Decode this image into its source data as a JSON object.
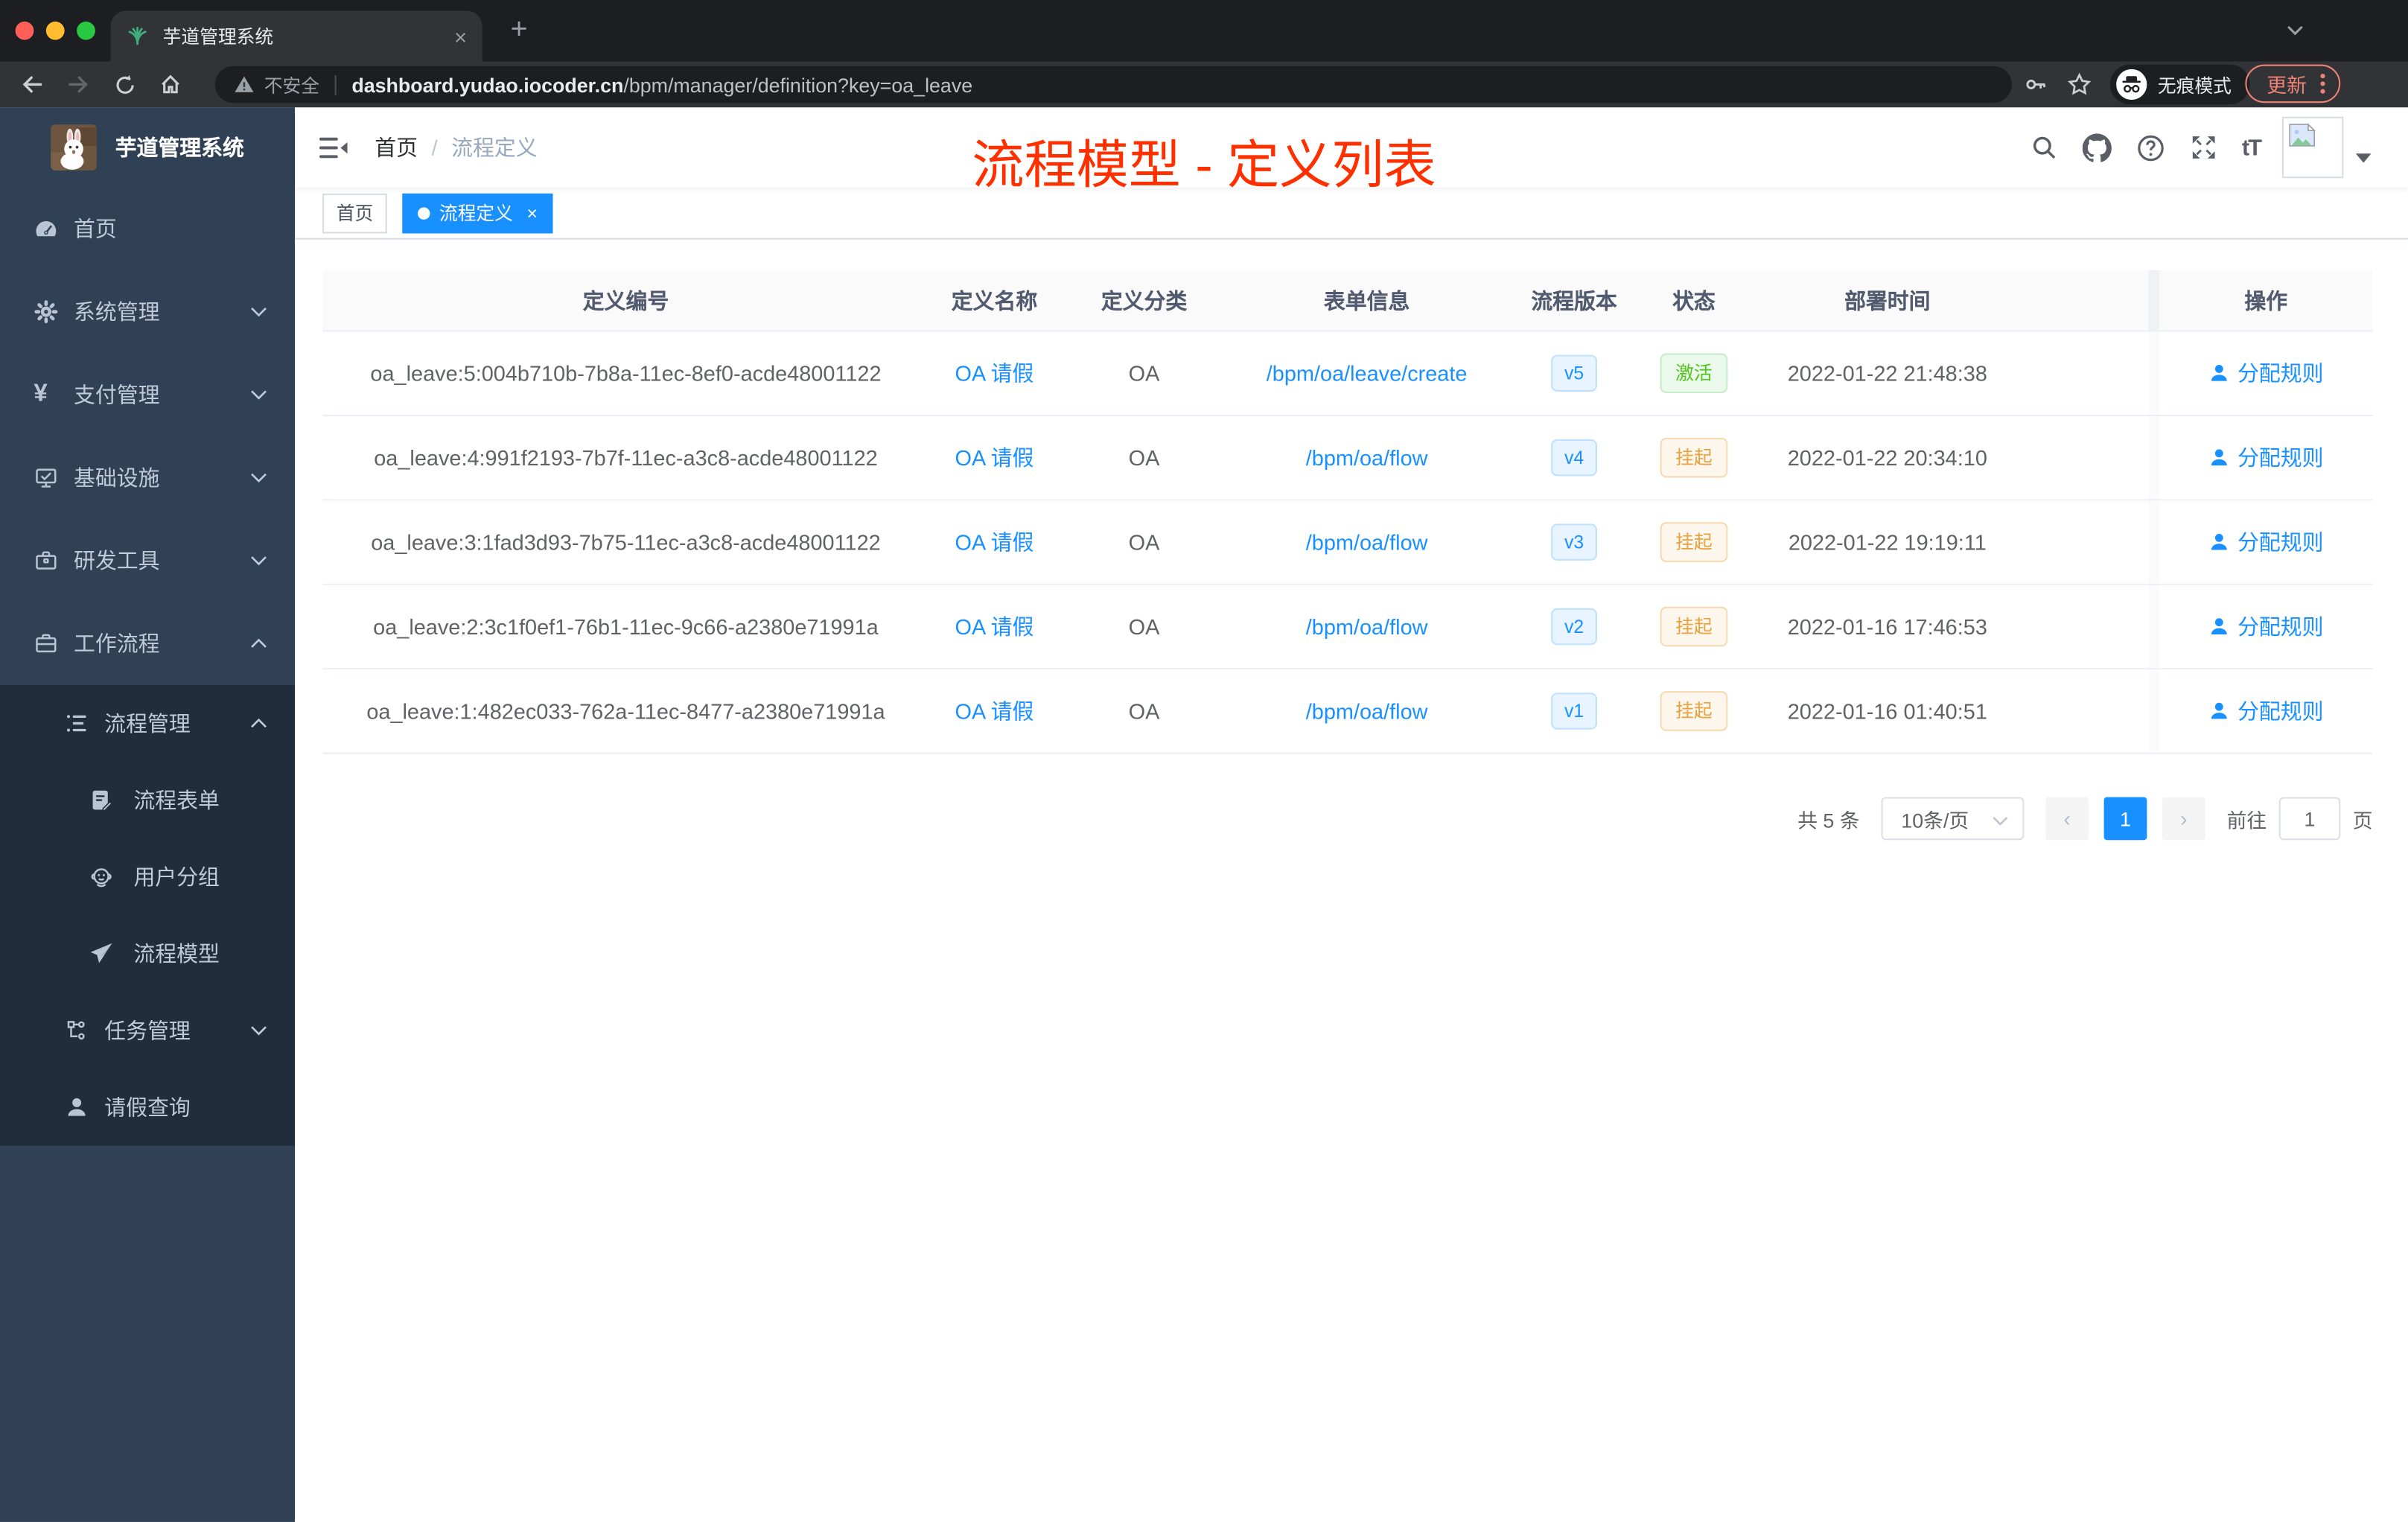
{
  "browser": {
    "tab_title": "芋道管理系统",
    "new_tab_label": "+",
    "close_tab_label": "×",
    "security_label": "不安全",
    "url_host": "dashboard.yudao.iocoder.cn",
    "url_path": "/bpm/manager/definition?key=oa_leave",
    "incognito_label": "无痕模式",
    "update_label": "更新",
    "icons": [
      "back-icon",
      "forward-icon",
      "reload-icon",
      "home-icon",
      "warning-icon",
      "key-icon",
      "star-icon",
      "incognito-icon",
      "kebab-menu-icon",
      "plant-favicon"
    ]
  },
  "sidebar": {
    "logo_title": "芋道管理系统",
    "items": [
      {
        "label": "首页",
        "icon": "gauge-icon"
      },
      {
        "label": "系统管理",
        "icon": "gear-icon",
        "expand": "collapsed"
      },
      {
        "label": "支付管理",
        "icon": "yen-icon",
        "expand": "collapsed"
      },
      {
        "label": "基础设施",
        "icon": "monitor-icon",
        "expand": "collapsed"
      },
      {
        "label": "研发工具",
        "icon": "toolbox-icon",
        "expand": "collapsed"
      },
      {
        "label": "工作流程",
        "icon": "briefcase-icon",
        "expand": "expanded"
      },
      {
        "label": "流程管理",
        "icon": "list-icon",
        "expand": "expanded"
      },
      {
        "label": "流程表单",
        "icon": "form-icon"
      },
      {
        "label": "用户分组",
        "icon": "robot-icon"
      },
      {
        "label": "流程模型",
        "icon": "paper-plane-icon"
      },
      {
        "label": "任务管理",
        "icon": "workflow-icon",
        "expand": "collapsed"
      },
      {
        "label": "请假查询",
        "icon": "user-icon"
      }
    ]
  },
  "header": {
    "breadcrumb_home": "首页",
    "breadcrumb_sep": "/",
    "breadcrumb_current": "流程定义",
    "overlay_title": "流程模型 - 定义列表",
    "right_icons": [
      "search-icon",
      "github-icon",
      "help-icon",
      "fullscreen-icon",
      "font-size-icon",
      "avatar",
      "caret-down-icon"
    ]
  },
  "tags": {
    "home": "首页",
    "active": "流程定义",
    "active_close": "×"
  },
  "table": {
    "columns": [
      "定义编号",
      "定义名称",
      "定义分类",
      "表单信息",
      "流程版本",
      "状态",
      "部署时间",
      "操作"
    ],
    "rows": [
      {
        "id": "oa_leave:5:004b710b-7b8a-11ec-8ef0-acde48001122",
        "name": "OA 请假",
        "category": "OA",
        "form": "/bpm/oa/leave/create",
        "version": "v5",
        "status": "激活",
        "status_type": "success",
        "time": "2022-01-22 21:48:38",
        "action": "分配规则"
      },
      {
        "id": "oa_leave:4:991f2193-7b7f-11ec-a3c8-acde48001122",
        "name": "OA 请假",
        "category": "OA",
        "form": "/bpm/oa/flow",
        "version": "v4",
        "status": "挂起",
        "status_type": "warning",
        "time": "2022-01-22 20:34:10",
        "action": "分配规则"
      },
      {
        "id": "oa_leave:3:1fad3d93-7b75-11ec-a3c8-acde48001122",
        "name": "OA 请假",
        "category": "OA",
        "form": "/bpm/oa/flow",
        "version": "v3",
        "status": "挂起",
        "status_type": "warning",
        "time": "2022-01-22 19:19:11",
        "action": "分配规则"
      },
      {
        "id": "oa_leave:2:3c1f0ef1-76b1-11ec-9c66-a2380e71991a",
        "name": "OA 请假",
        "category": "OA",
        "form": "/bpm/oa/flow",
        "version": "v2",
        "status": "挂起",
        "status_type": "warning",
        "time": "2022-01-16 17:46:53",
        "action": "分配规则"
      },
      {
        "id": "oa_leave:1:482ec033-762a-11ec-8477-a2380e71991a",
        "name": "OA 请假",
        "category": "OA",
        "form": "/bpm/oa/flow",
        "version": "v1",
        "status": "挂起",
        "status_type": "warning",
        "time": "2022-01-16 01:40:51",
        "action": "分配规则"
      }
    ]
  },
  "pagination": {
    "total": "共 5 条",
    "page_size": "10条/页",
    "prev": "‹",
    "current": "1",
    "next": "›",
    "goto_label": "前往",
    "goto_value": "1",
    "unit_label": "页"
  },
  "colors": {
    "primary": "#1890ff",
    "sidebar_bg": "#304156",
    "sidebar_submenu_bg": "#1f2d3d",
    "overlay_title": "#ff3000",
    "status_active": "#52c41a",
    "status_suspended": "#e6a23c"
  }
}
